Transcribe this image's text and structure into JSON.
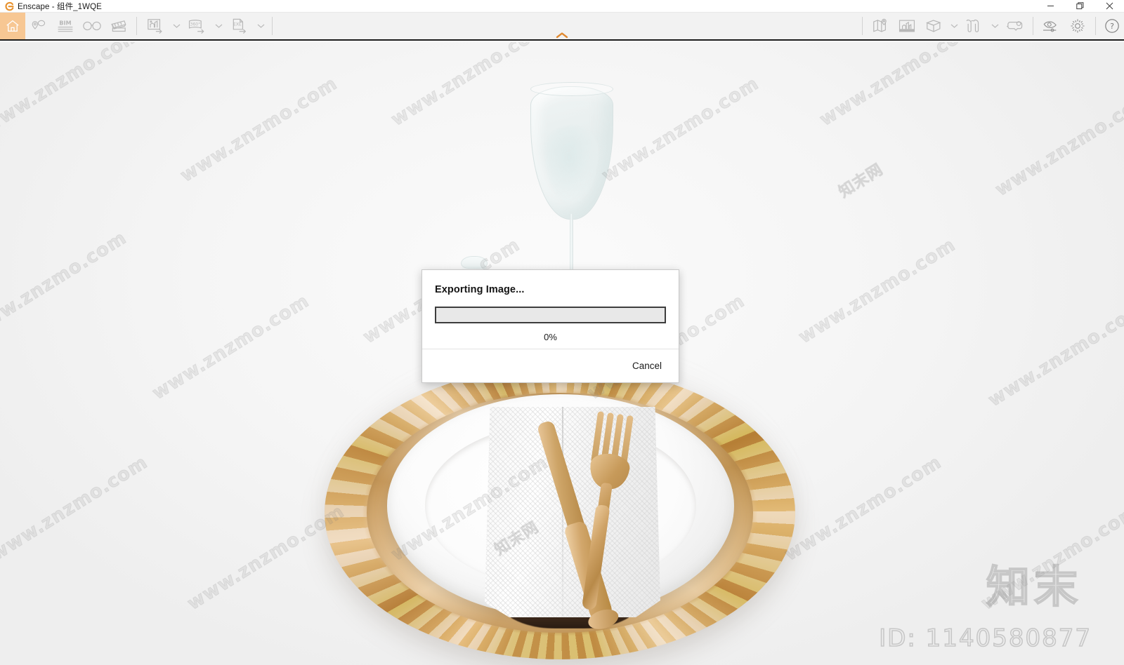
{
  "window": {
    "app_icon": "enscape-logo-icon",
    "title": "Enscape - 组件_1WQE",
    "controls": {
      "minimize": "minimize-icon",
      "restore": "restore-icon",
      "close": "close-icon"
    }
  },
  "toolbar": {
    "left_items": [
      {
        "name": "home",
        "icon": "home-icon",
        "label": "Home",
        "active": true
      },
      {
        "name": "views",
        "icon": "views-pin-icon",
        "label": "Views"
      },
      {
        "name": "bim",
        "icon": "bim-icon",
        "label": "BIM"
      },
      {
        "name": "visual-settings",
        "icon": "glasses-icon",
        "label": "Visual Settings"
      },
      {
        "name": "video-editor",
        "icon": "clapperboard-icon",
        "label": "Video Editor"
      },
      {
        "name": "render-image",
        "icon": "render-image-export-icon",
        "label": "Render Image"
      },
      {
        "name": "render-image-dropdown",
        "icon": "chevron-down-icon",
        "label": ""
      },
      {
        "name": "panorama",
        "icon": "panorama-360-export-icon",
        "label": "360 Panorama"
      },
      {
        "name": "panorama-dropdown",
        "icon": "chevron-down-icon",
        "label": ""
      },
      {
        "name": "standalone-exe",
        "icon": "exe-export-icon",
        "label": "Standalone EXE"
      },
      {
        "name": "standalone-exe-dropdown",
        "icon": "chevron-down-icon",
        "label": ""
      }
    ],
    "right_items": [
      {
        "name": "asset-library",
        "icon": "map-pin-icon",
        "label": "Asset Library"
      },
      {
        "name": "material-editor",
        "icon": "picture-frame-icon",
        "label": "Material Editor"
      },
      {
        "name": "projection-mode",
        "icon": "cube-icon",
        "label": "Projection Mode"
      },
      {
        "name": "projection-dropdown",
        "icon": "chevron-down-icon",
        "label": ""
      },
      {
        "name": "stereo-mode",
        "icon": "stereo-view-icon",
        "label": "Stereo"
      },
      {
        "name": "stereo-dropdown",
        "icon": "chevron-down-icon",
        "label": ""
      },
      {
        "name": "vr-mode",
        "icon": "vr-headset-icon",
        "label": "VR Mode"
      },
      {
        "name": "visual-preview",
        "icon": "eye-slider-icon",
        "label": "Preview"
      },
      {
        "name": "settings",
        "icon": "gear-icon",
        "label": "Settings"
      },
      {
        "name": "help",
        "icon": "help-question-icon",
        "label": "Help"
      }
    ],
    "collapse": {
      "icon": "chevron-up-icon",
      "color": "#e08a32"
    },
    "accent_color": "#f7c793",
    "background_color": "#f2f2f2"
  },
  "dialog": {
    "title": "Exporting Image...",
    "percent_label": "0%",
    "progress_value": 0,
    "cancel_label": "Cancel"
  },
  "viewport": {
    "scene_description": "rendered table setting with gold charger plate, white dinner plate, folded napkin, gold fork and knife, wine glass and shaker",
    "background_color": "#f4f4f4"
  },
  "watermarks": {
    "diagonal_text": "www.znzmo.com",
    "brand_text": "知末",
    "id_text": "ID: 1140580877",
    "tile_text": "知末网"
  }
}
